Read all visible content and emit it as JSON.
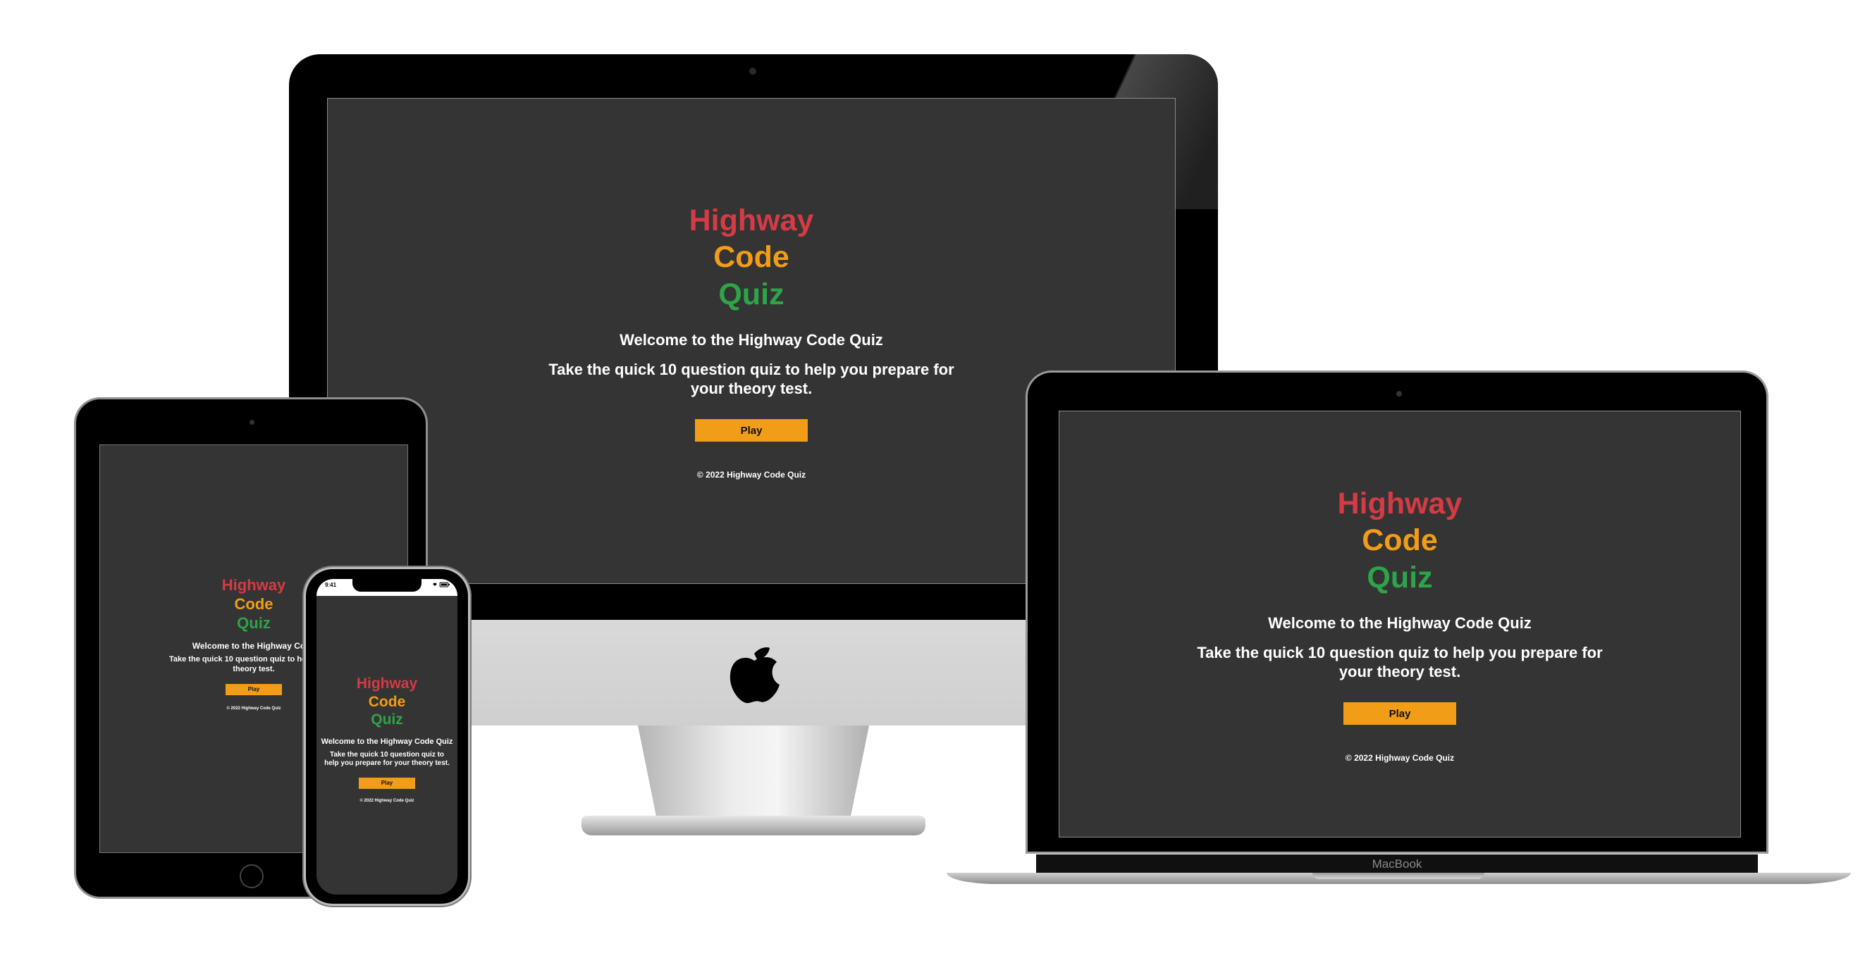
{
  "app": {
    "title_line1": "Highway",
    "title_line2": "Code",
    "title_line3": "Quiz",
    "welcome": "Welcome to the Highway Code Quiz",
    "intro": "Take the quick 10 question quiz to help you prepare for your theory test.",
    "play_label": "Play",
    "footer": "© 2022 Highway Code Quiz"
  },
  "ipad": {
    "welcome": "Welcome to the Highway Code",
    "intro": "Take the quick 10 question quiz to help y your theory test."
  },
  "iphone": {
    "time": "9:41",
    "status_icons": "signal-wifi-battery"
  },
  "devices": {
    "laptop_label": "MacBook"
  },
  "colors": {
    "background": "#343434",
    "title_red": "#d43b45",
    "title_orange": "#f29d17",
    "title_green": "#2ea449",
    "button": "#f29d17"
  }
}
